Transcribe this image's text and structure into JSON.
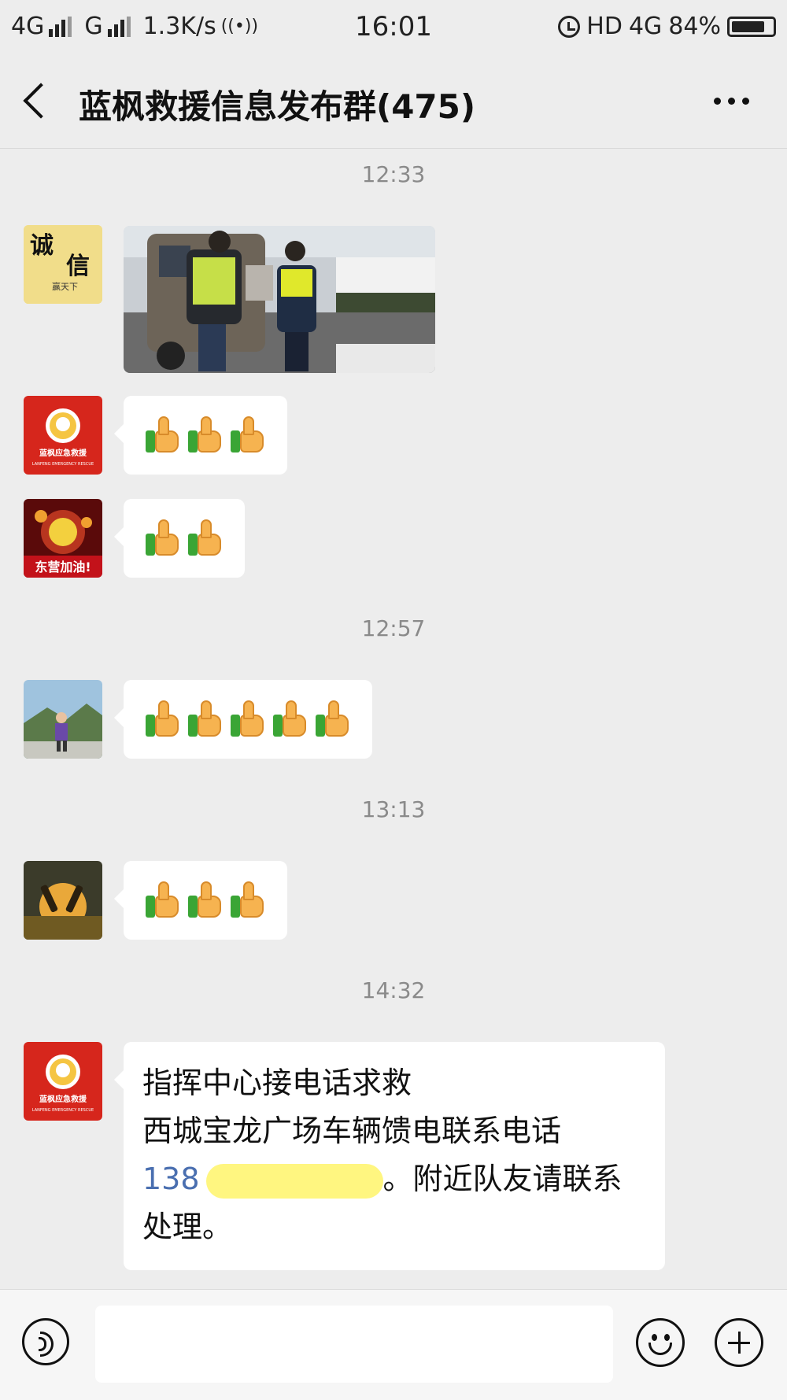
{
  "status_bar": {
    "network1": "4G",
    "network2": "G",
    "speed": "1.3K/s",
    "time": "16:01",
    "hd": "HD",
    "network3": "4G",
    "battery": "84%",
    "battery_level": 0.84
  },
  "header": {
    "title": "蓝枫救援信息发布群(475)"
  },
  "timestamps": [
    "12:33",
    "12:57",
    "13:13",
    "14:32"
  ],
  "avatars": {
    "a1_text1": "诚",
    "a1_text2": "信",
    "a1_text3": "赢天下",
    "a2_text": "蓝枫应急救援",
    "a2_sub": "LANFENG EMERGENCY RESCUE",
    "a3_text": "东营加油!"
  },
  "messages": [
    {
      "type": "image"
    },
    {
      "type": "emoji",
      "icon": "thumbs-up-icon",
      "count": 3
    },
    {
      "type": "emoji",
      "icon": "thumbs-up-icon",
      "count": 2
    },
    {
      "type": "emoji",
      "icon": "thumbs-up-icon",
      "count": 5
    },
    {
      "type": "emoji",
      "icon": "thumbs-up-icon",
      "count": 3
    },
    {
      "type": "text",
      "line1": "指挥中心接电话求救",
      "line2": "西城宝龙广场车辆馈电联系电话",
      "phone": "138",
      "line3": "。附近队友请联系",
      "line4": "处理。"
    }
  ],
  "input_bar": {
    "voice_icon": "voice-icon",
    "emoji_icon": "emoji-icon",
    "plus_icon": "plus-icon"
  },
  "colors": {
    "background": "#ededed",
    "bubble": "#ffffff",
    "link": "#4a6fb0",
    "redaction": "#fff680",
    "avatar_red": "#d6261c"
  }
}
